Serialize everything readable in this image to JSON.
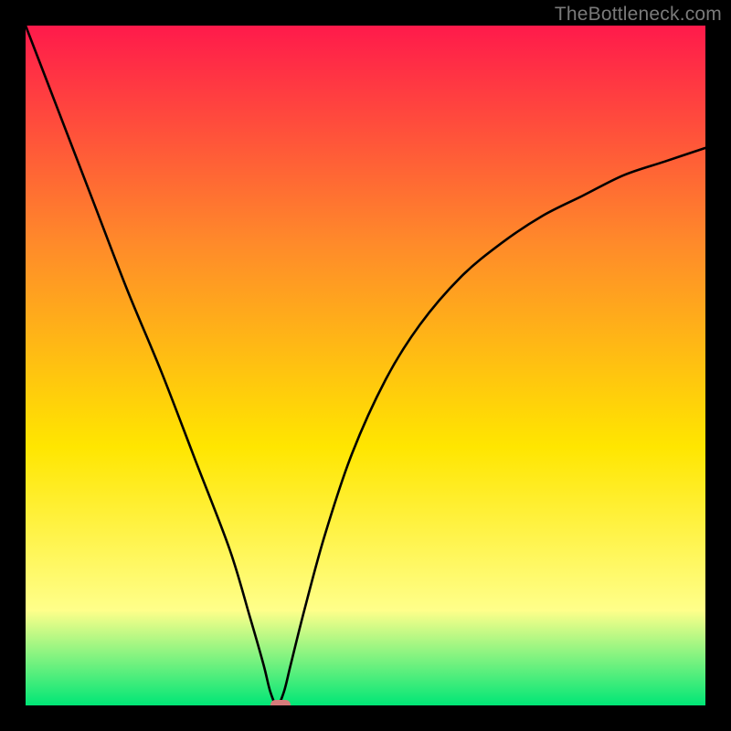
{
  "watermark": "TheBottleneck.com",
  "chart_data": {
    "type": "line",
    "title": "",
    "xlabel": "",
    "ylabel": "",
    "xlim": [
      0,
      100
    ],
    "ylim": [
      0,
      100
    ],
    "gradient_colors": {
      "top": "#ff1a4b",
      "upper": "#ff8a2a",
      "mid": "#ffe600",
      "lower": "#ffff8a",
      "bottom": "#00e676"
    },
    "min_x": 37,
    "marker": {
      "x": 37.5,
      "y": 0,
      "color": "#d77b7b"
    },
    "curve": [
      {
        "x": 0,
        "y": 100
      },
      {
        "x": 5,
        "y": 87
      },
      {
        "x": 10,
        "y": 74
      },
      {
        "x": 15,
        "y": 61
      },
      {
        "x": 20,
        "y": 49
      },
      {
        "x": 25,
        "y": 36
      },
      {
        "x": 30,
        "y": 23
      },
      {
        "x": 33,
        "y": 13
      },
      {
        "x": 35,
        "y": 6
      },
      {
        "x": 36,
        "y": 2
      },
      {
        "x": 37,
        "y": 0
      },
      {
        "x": 38,
        "y": 2
      },
      {
        "x": 39,
        "y": 6
      },
      {
        "x": 41,
        "y": 14
      },
      {
        "x": 44,
        "y": 25
      },
      {
        "x": 48,
        "y": 37
      },
      {
        "x": 53,
        "y": 48
      },
      {
        "x": 58,
        "y": 56
      },
      {
        "x": 64,
        "y": 63
      },
      {
        "x": 70,
        "y": 68
      },
      {
        "x": 76,
        "y": 72
      },
      {
        "x": 82,
        "y": 75
      },
      {
        "x": 88,
        "y": 78
      },
      {
        "x": 94,
        "y": 80
      },
      {
        "x": 100,
        "y": 82
      }
    ]
  }
}
